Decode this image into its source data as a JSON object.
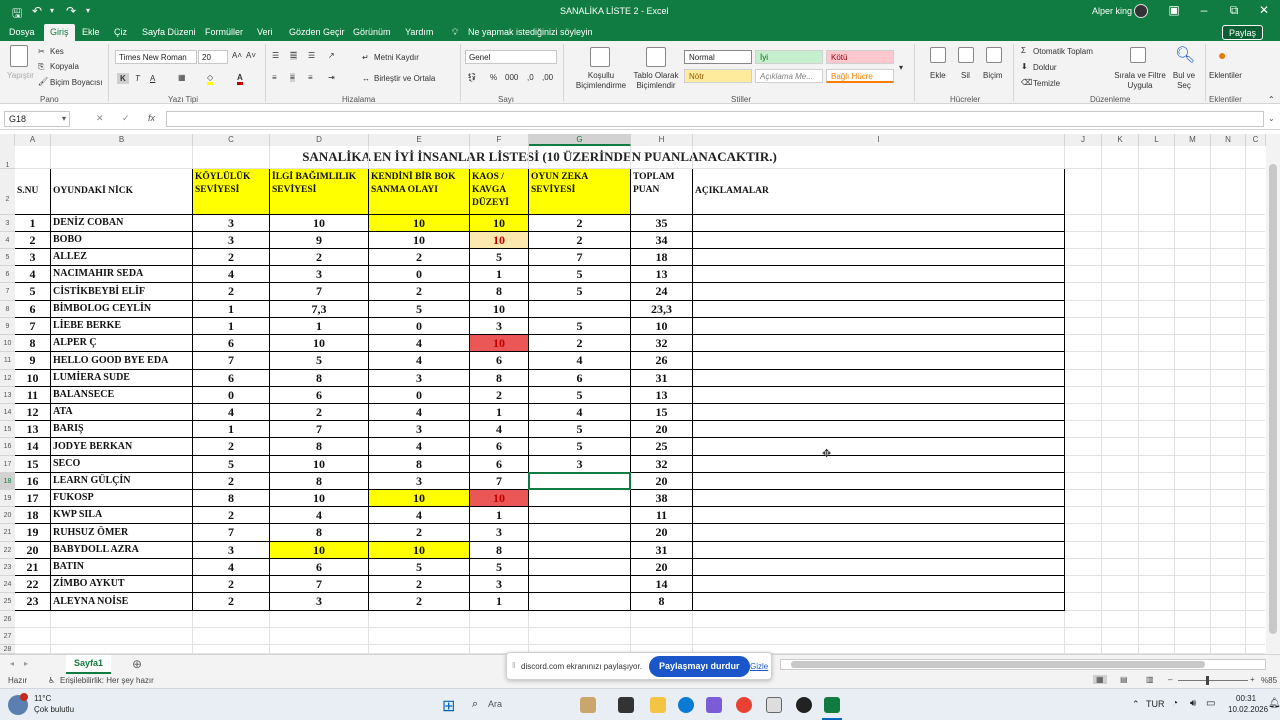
{
  "app": {
    "title": "SANALİKA LİSTE 2  -  Excel",
    "user": "Alper king",
    "search_hint": "Ne yapmak istediğinizi söyleyin",
    "share": "Paylaş"
  },
  "menu": [
    "Dosya",
    "Giriş",
    "Ekle",
    "Çiz",
    "Sayfa Düzeni",
    "Formüller",
    "Veri",
    "Gözden Geçir",
    "Görünüm",
    "Yardım"
  ],
  "ribbon": {
    "clipboard": {
      "paste": "Yapıştır",
      "cut": "Kes",
      "copy": "Kopyala",
      "format_painter": "Biçim Boyacısı",
      "group": "Pano"
    },
    "font": {
      "name": "Times New Roman",
      "size": "20",
      "group": "Yazı Tipi"
    },
    "alignment": {
      "wrap": "Metni Kaydır",
      "merge": "Birleştir ve Ortala",
      "group": "Hizalama"
    },
    "number": {
      "format": "Genel",
      "group": "Sayı"
    },
    "styles": {
      "conditional": "Koşullu Biçimlendirme",
      "table": "Tablo Olarak Biçimlendir",
      "normal": "Normal",
      "iyi": "İyi",
      "kotu": "Kötü",
      "notr": "Nötr",
      "aciklama": "Açıklama Me...",
      "bagli": "Bağlı Hücre",
      "group": "Stiller"
    },
    "cells": {
      "insert": "Ekle",
      "delete": "Sil",
      "format": "Biçim",
      "group": "Hücreler"
    },
    "editing": {
      "autosum": "Otomatik Toplam",
      "fill": "Doldur",
      "clear": "Temizle",
      "sort": "Sırala ve Filtre Uygula",
      "find": "Bul ve Seç",
      "group": "Düzenleme"
    },
    "addins": {
      "label": "Eklentiler",
      "group": "Eklentiler"
    }
  },
  "formula_bar": {
    "name_box": "G18",
    "fx": "fx",
    "value": ""
  },
  "columns": [
    "A",
    "B",
    "C",
    "D",
    "E",
    "F",
    "G",
    "H",
    "I",
    "J",
    "K",
    "L",
    "M",
    "N",
    "C"
  ],
  "sheet": {
    "title": "SANALİKA EN İYİ İNSANLAR LİSTESİ  (10 ÜZERİNDEN PUANLANACAKTIR.)",
    "headers": [
      "S.NU",
      "OYUNDAKİ NİCK",
      "KÖYLÜLÜK SEVİYESİ",
      "İLGİ BAĞIMLILIK SEVİYESİ",
      "KENDİNİ BİR BOK SANMA OLAYI",
      "KAOS / KAVGA DÜZEYİ",
      "OYUN ZEKA SEVİYESİ",
      "TOPLAM PUAN",
      "AÇIKLAMALAR"
    ],
    "rows": [
      [
        "1",
        "DENİZ COBAN",
        "3",
        "10",
        "10",
        "10",
        "2",
        "35"
      ],
      [
        "2",
        "BOBO",
        "3",
        "9",
        "10",
        "10",
        "2",
        "34"
      ],
      [
        "3",
        "ALLEZ",
        "2",
        "2",
        "2",
        "5",
        "7",
        "18"
      ],
      [
        "4",
        "NACIMAHIR SEDA",
        "4",
        "3",
        "0",
        "1",
        "5",
        "13"
      ],
      [
        "5",
        "CİSTİKBEYBİ ELİF",
        "2",
        "7",
        "2",
        "8",
        "5",
        "24"
      ],
      [
        "6",
        "BİMBOLOG CEYLİN",
        "1",
        "7,3",
        "5",
        "10",
        "",
        "23,3"
      ],
      [
        "7",
        "LİEBE BERKE",
        "1",
        "1",
        "0",
        "3",
        "5",
        "10"
      ],
      [
        "8",
        "ALPER Ç",
        "6",
        "10",
        "4",
        "10",
        "2",
        "32"
      ],
      [
        "9",
        "HELLO GOOD BYE EDA",
        "7",
        "5",
        "4",
        "6",
        "4",
        "26"
      ],
      [
        "10",
        "LUMİERA SUDE",
        "6",
        "8",
        "3",
        "8",
        "6",
        "31"
      ],
      [
        "11",
        "BALANSECE",
        "0",
        "6",
        "0",
        "2",
        "5",
        "13"
      ],
      [
        "12",
        "ATA",
        "4",
        "2",
        "4",
        "1",
        "4",
        "15"
      ],
      [
        "13",
        "BARIŞ",
        "1",
        "7",
        "3",
        "4",
        "5",
        "20"
      ],
      [
        "14",
        "JODYE BERKAN",
        "2",
        "8",
        "4",
        "6",
        "5",
        "25"
      ],
      [
        "15",
        "SECO",
        "5",
        "10",
        "8",
        "6",
        "3",
        "32"
      ],
      [
        "16",
        "LEARN GÜLÇİN",
        "2",
        "8",
        "3",
        "7",
        "",
        "20"
      ],
      [
        "17",
        "FUKOSP",
        "8",
        "10",
        "10",
        "10",
        "",
        "38"
      ],
      [
        "18",
        "KWP SILA",
        "2",
        "4",
        "4",
        "1",
        "",
        "11"
      ],
      [
        "19",
        "RUHSUZ ÖMER",
        "7",
        "8",
        "2",
        "3",
        "",
        "20"
      ],
      [
        "20",
        "BABYDOLL AZRA",
        "3",
        "10",
        "10",
        "8",
        "",
        "31"
      ],
      [
        "21",
        "BATIN",
        "4",
        "6",
        "5",
        "5",
        "",
        "20"
      ],
      [
        "22",
        "ZİMBO AYKUT",
        "2",
        "7",
        "2",
        "3",
        "",
        "14"
      ],
      [
        "23",
        "ALEYNA NOİSE",
        "2",
        "3",
        "2",
        "1",
        "",
        "8"
      ]
    ]
  },
  "row_numbers": [
    "1",
    "2",
    "3",
    "4",
    "5",
    "6",
    "7",
    "8",
    "9",
    "10",
    "11",
    "12",
    "13",
    "14",
    "15",
    "16",
    "17",
    "18",
    "19",
    "20",
    "21",
    "22",
    "23",
    "24",
    "25",
    "26",
    "27",
    "28"
  ],
  "sheet_tab": "Sayfa1",
  "status": {
    "ready": "Hazır",
    "accessibility": "Erişilebilirlik: Her şey hazır",
    "zoom": "%85"
  },
  "toast": {
    "message": "discord.com ekranınızı paylaşıyor.",
    "stop": "Paylaşmayı durdur",
    "hide": "Gizle"
  },
  "taskbar": {
    "weather_temp": "11°C",
    "weather_desc": "Çok bulutlu",
    "search": "Ara",
    "lang": "TUR",
    "time": "00:31",
    "date": "10.02.2026"
  },
  "colors": {
    "excel_green": "#107c41",
    "highlight_yellow": "#ffff00",
    "highlight_red": "#eb5656",
    "highlight_orange": "#fde9b0"
  }
}
